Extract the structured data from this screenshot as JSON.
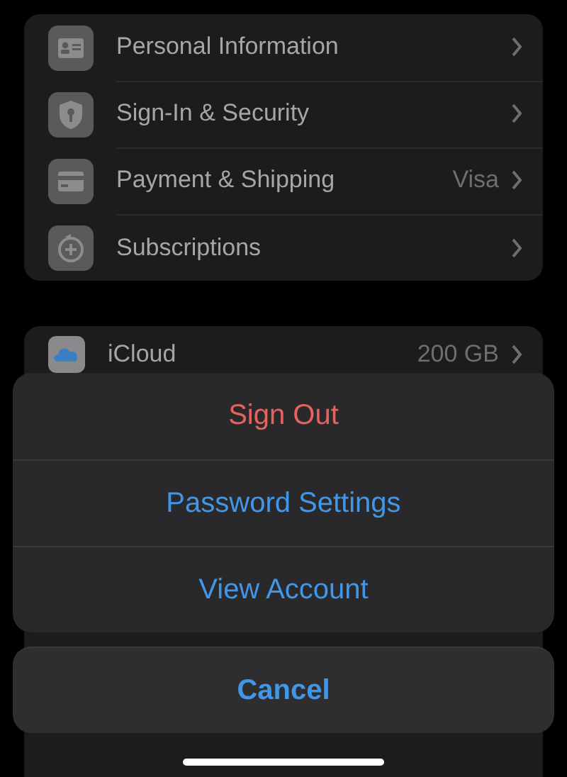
{
  "account_menu": [
    {
      "label": "Personal Information"
    },
    {
      "label": "Sign-In & Security"
    },
    {
      "label": "Payment & Shipping",
      "value": "Visa"
    },
    {
      "label": "Subscriptions"
    }
  ],
  "services": [
    {
      "label": "iCloud",
      "value": "200 GB"
    }
  ],
  "action_sheet": {
    "actions": [
      {
        "label": "Sign Out",
        "kind": "destructive"
      },
      {
        "label": "Password Settings",
        "kind": "default"
      },
      {
        "label": "View Account",
        "kind": "default"
      }
    ],
    "cancel": {
      "label": "Cancel"
    }
  }
}
